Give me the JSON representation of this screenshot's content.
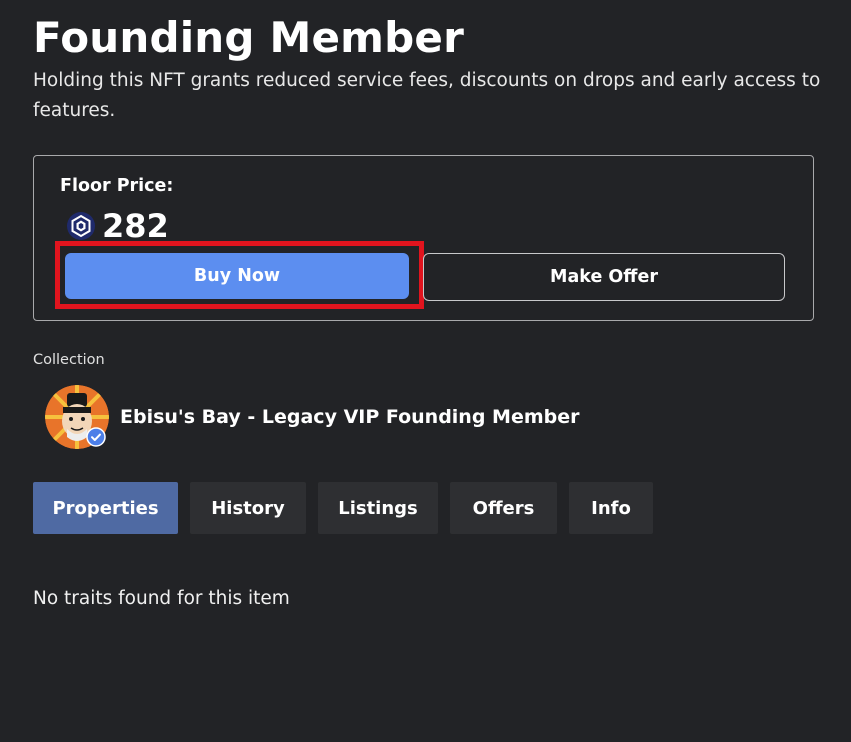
{
  "header": {
    "title": "Founding Member",
    "description": "Holding this NFT grants reduced service fees, discounts on drops and early access to features."
  },
  "price_card": {
    "floor_label": "Floor Price:",
    "price": "282",
    "currency_icon": "cronos-icon",
    "buy_label": "Buy Now",
    "offer_label": "Make Offer"
  },
  "collection": {
    "label": "Collection",
    "name": "Ebisu's Bay - Legacy VIP Founding Member",
    "verified_icon": "verified-check-icon"
  },
  "tabs": [
    {
      "label": "Properties",
      "active": true
    },
    {
      "label": "History",
      "active": false
    },
    {
      "label": "Listings",
      "active": false
    },
    {
      "label": "Offers",
      "active": false
    },
    {
      "label": "Info",
      "active": false
    }
  ],
  "properties": {
    "empty_text": "No traits found for this item"
  },
  "colors": {
    "background": "#222326",
    "accent": "#5c8ef0",
    "active_tab": "#4f6aa3",
    "tab": "#2e2f32",
    "highlight": "#e1141e"
  }
}
